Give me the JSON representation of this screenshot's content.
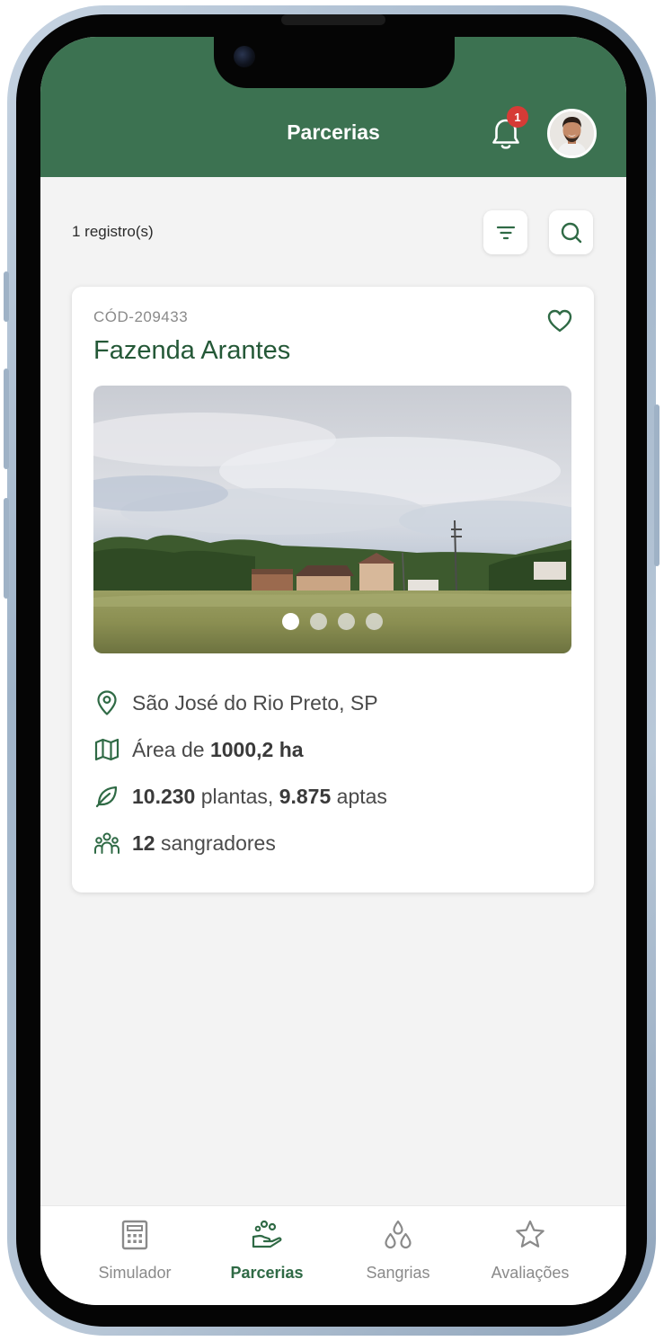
{
  "header": {
    "title": "Parcerias",
    "notification_count": "1"
  },
  "toolbar": {
    "record_count": "1 registro(s)"
  },
  "listing": {
    "code": "CÓD-209433",
    "name": "Fazenda Arantes",
    "carousel_total": 4,
    "carousel_active": 1,
    "location": "São José do Rio Preto, SP",
    "area_prefix": "Área de ",
    "area_value": "1000,2 ha",
    "plants_value": "10.230",
    "plants_mid": " plantas, ",
    "apt_value": "9.875",
    "apt_suffix": " aptas",
    "tappers_value": "12",
    "tappers_suffix": " sangradores"
  },
  "tabs": [
    {
      "label": "Simulador",
      "icon": "calculator-icon",
      "active": false
    },
    {
      "label": "Parcerias",
      "icon": "hand-seedling-icon",
      "active": true
    },
    {
      "label": "Sangrias",
      "icon": "droplets-icon",
      "active": false
    },
    {
      "label": "Avaliações",
      "icon": "star-icon",
      "active": false
    }
  ],
  "colors": {
    "brand_green": "#3c7251",
    "title_green": "#245837",
    "badge_red": "#d63b36",
    "background": "#f3f3f3"
  }
}
